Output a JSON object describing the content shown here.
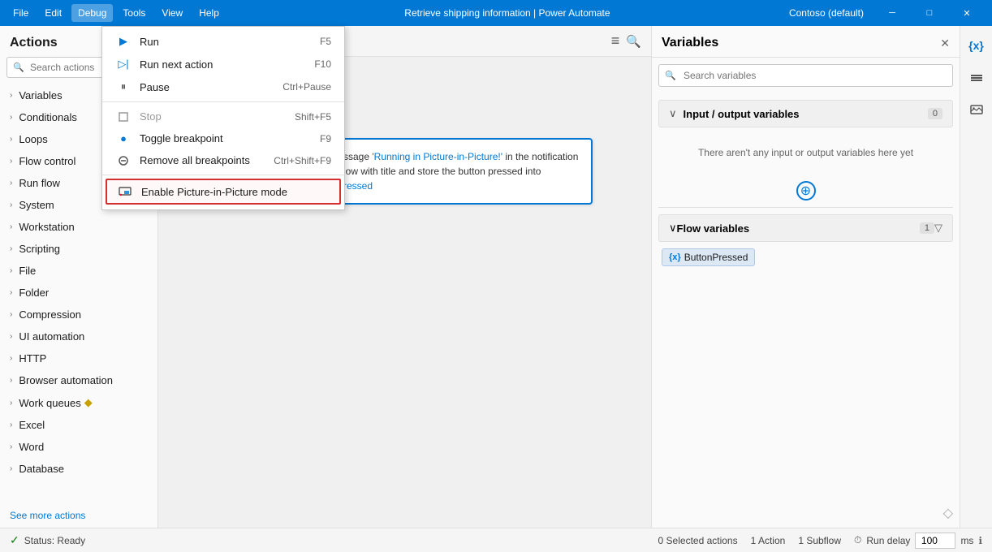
{
  "titlebar": {
    "menu": [
      "File",
      "Edit",
      "Debug",
      "Tools",
      "View",
      "Help"
    ],
    "active_menu": "Debug",
    "title": "Retrieve shipping information | Power Automate",
    "account": "Contoso (default)",
    "controls": [
      "─",
      "□",
      "✕"
    ]
  },
  "actions_panel": {
    "header": "Actions",
    "search_placeholder": "Search actions",
    "items": [
      {
        "label": "Variables"
      },
      {
        "label": "Conditionals"
      },
      {
        "label": "Loops"
      },
      {
        "label": "Flow control"
      },
      {
        "label": "Run flow"
      },
      {
        "label": "System"
      },
      {
        "label": "Workstation"
      },
      {
        "label": "Scripting"
      },
      {
        "label": "File"
      },
      {
        "label": "Folder"
      },
      {
        "label": "Compression"
      },
      {
        "label": "UI automation"
      },
      {
        "label": "HTTP"
      },
      {
        "label": "Browser automation"
      },
      {
        "label": "Work queues"
      },
      {
        "label": "Excel"
      },
      {
        "label": "Word"
      },
      {
        "label": "Database"
      }
    ],
    "see_more": "See more actions"
  },
  "debug_menu": {
    "items": [
      {
        "icon": "▶",
        "label": "Run",
        "shortcut": "F5",
        "type": "run"
      },
      {
        "icon": "▶|",
        "label": "Run next action",
        "shortcut": "F10",
        "type": "run-next"
      },
      {
        "icon": "||",
        "label": "Pause",
        "shortcut": "Ctrl+Pause",
        "type": "pause"
      },
      {
        "separator": true
      },
      {
        "icon": "□",
        "label": "Stop",
        "shortcut": "Shift+F5",
        "type": "stop"
      },
      {
        "separator": false
      },
      {
        "icon": "●",
        "label": "Toggle breakpoint",
        "shortcut": "F9",
        "type": "breakpoint"
      },
      {
        "icon": "⊗",
        "label": "Remove all breakpoints",
        "shortcut": "Ctrl+Shift+F9",
        "type": "remove-bp"
      },
      {
        "separator": true
      },
      {
        "icon": "📷",
        "label": "Enable Picture-in-Picture mode",
        "shortcut": "",
        "type": "pip",
        "highlighted": true
      }
    ]
  },
  "canvas": {
    "flow_card": {
      "text_prefix": "ssage ",
      "link_text": "'Running in Picture-in-Picture!'",
      "text_middle": " in the notification",
      "text_end": "low with title  and store the button pressed into",
      "link2": "ressed"
    }
  },
  "variables_panel": {
    "title": "Variables",
    "search_placeholder": "Search variables",
    "input_output": {
      "label": "Input / output variables",
      "count": "0",
      "empty_text": "There aren't any input or output variables here yet"
    },
    "flow_variables": {
      "label": "Flow variables",
      "count": "1",
      "items": [
        {
          "name": "ButtonPressed",
          "icon": "{x}"
        }
      ]
    }
  },
  "statusbar": {
    "status_icon": "✓",
    "status_text": "Status: Ready",
    "selected_actions": "0 Selected actions",
    "action_count": "1 Action",
    "subflow_count": "1 Subflow",
    "run_delay_label": "Run delay",
    "run_delay_value": "100",
    "run_delay_unit": "ms",
    "info_icon": "ℹ"
  },
  "icons": {
    "search": "🔍",
    "close": "✕",
    "bars": "≡",
    "magnify": "🔍",
    "layers": "⊞",
    "image": "🖼",
    "diamond": "◇",
    "filter": "▽",
    "chevron_right": "›",
    "chevron_down": "∨",
    "plus_circle": "⊕",
    "pip_icon": "📷"
  }
}
